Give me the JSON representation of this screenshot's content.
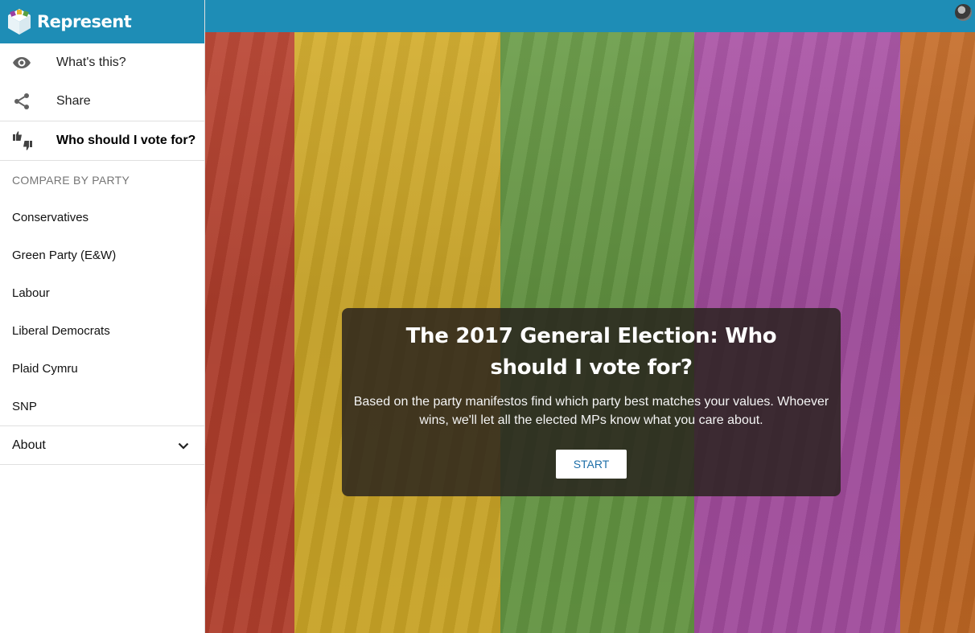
{
  "brand": {
    "name": "Represent"
  },
  "nav": [
    {
      "label": "What's this?",
      "icon": "eye-icon"
    },
    {
      "label": "Share",
      "icon": "share-icon"
    },
    {
      "label": "Who should I vote for?",
      "icon": "thumbs-up-down-icon"
    }
  ],
  "compare": {
    "heading": "COMPARE BY PARTY",
    "parties": [
      "Conservatives",
      "Green Party (E&W)",
      "Labour",
      "Liberal Democrats",
      "Plaid Cymru",
      "SNP"
    ]
  },
  "about": {
    "label": "About"
  },
  "hero": {
    "title": "The 2017 General Election: Who should I vote for?",
    "description": "Based on the party manifestos find which party best matches your values. Whoever wins, we'll let all the elected MPs know what you care about.",
    "start_label": "START"
  },
  "colors": {
    "brand": "#1e8db6",
    "stripes": [
      "#b8412e",
      "#d2ab28",
      "#679a44",
      "#a84fa3",
      "#c46a25"
    ]
  }
}
